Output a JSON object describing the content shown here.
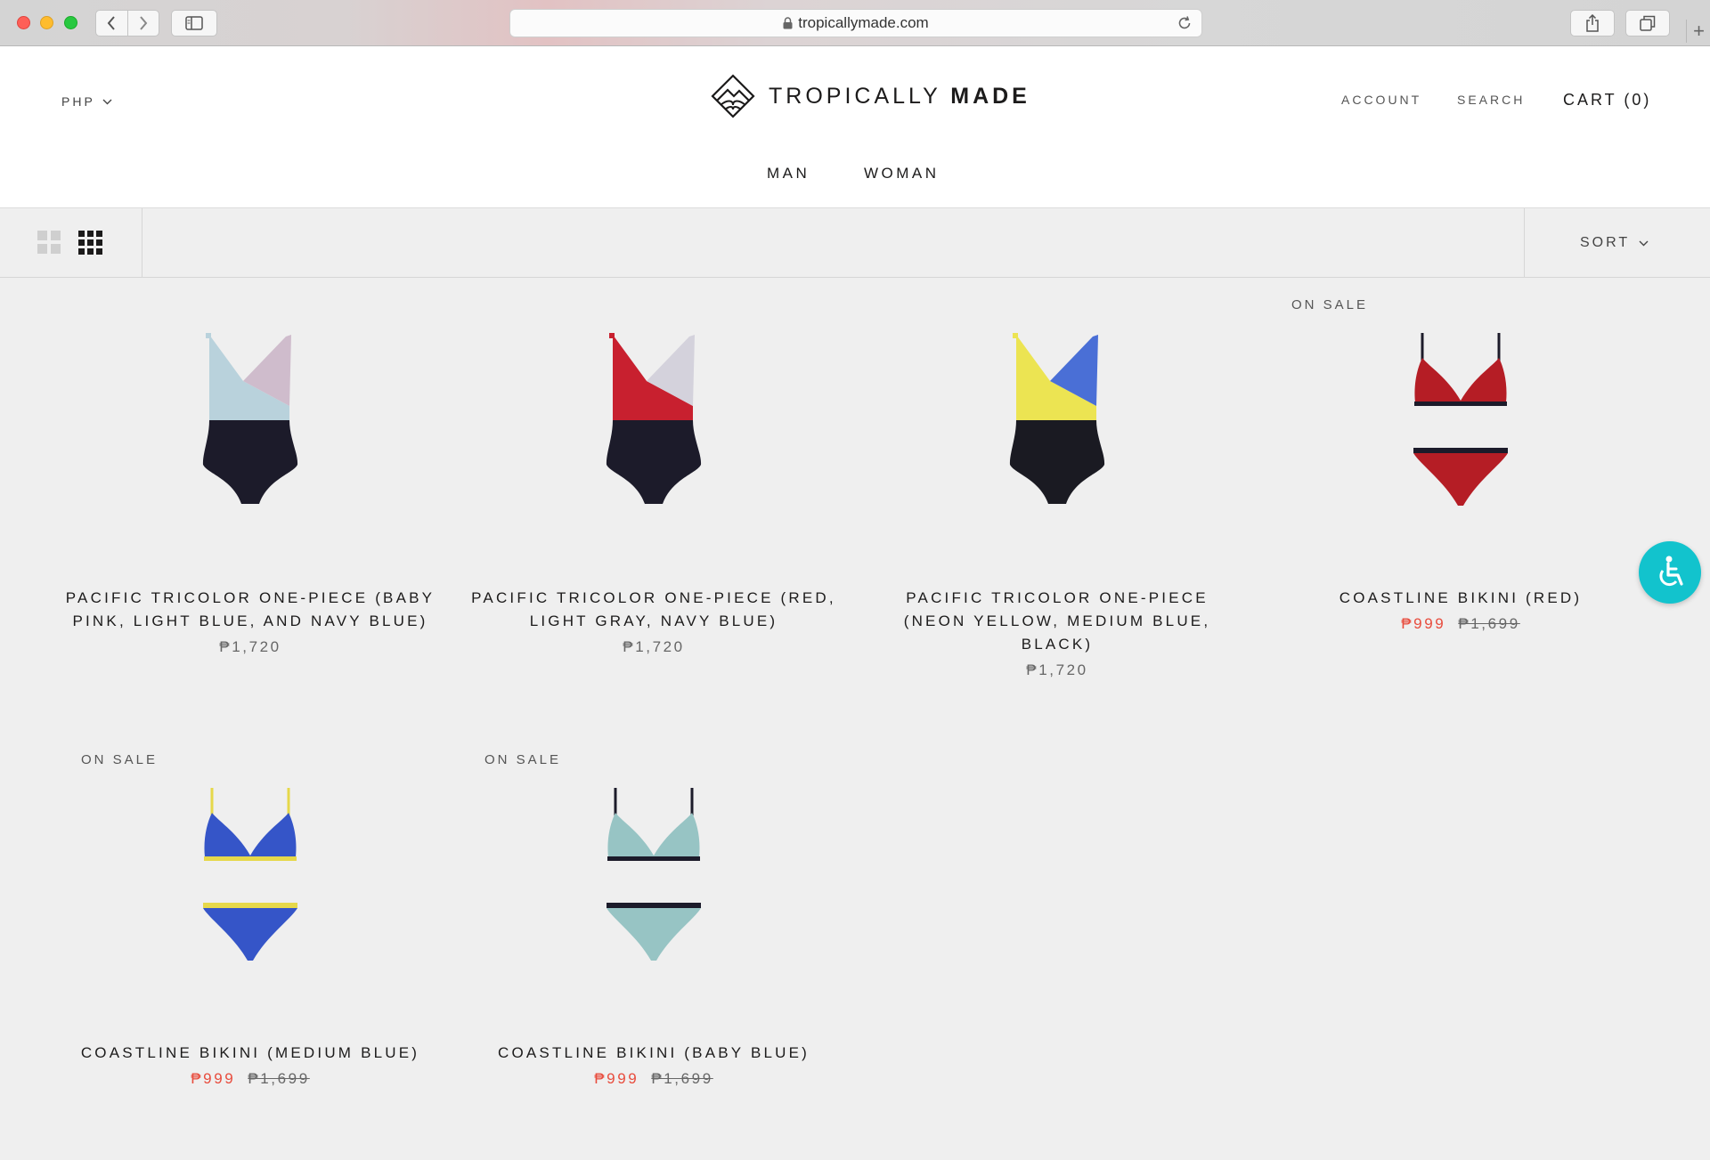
{
  "browser": {
    "url": "tropicallymade.com"
  },
  "header": {
    "currency": "PHP",
    "logo_light": "TROPICALLY ",
    "logo_bold": "MADE",
    "account": "ACCOUNT",
    "search": "SEARCH",
    "cart": "CART (0)",
    "nav": [
      "MAN",
      "WOMAN"
    ]
  },
  "toolbar": {
    "sort_label": "SORT"
  },
  "products": [
    {
      "title_lines": [
        "PACIFIC TRICOLOR ONE-PIECE (BABY",
        "PINK, LIGHT BLUE, AND NAVY BLUE)"
      ],
      "price": "₱1,720",
      "badge": "",
      "image": "onepiece",
      "colors": {
        "left": "#b9d2dc",
        "right": "#cfbccc",
        "bottom": "#1c1b2a"
      }
    },
    {
      "title_lines": [
        "PACIFIC TRICOLOR ONE-PIECE (RED,",
        "LIGHT GRAY, NAVY BLUE)"
      ],
      "price": "₱1,720",
      "badge": "",
      "image": "onepiece",
      "colors": {
        "left": "#c8202f",
        "right": "#d4d2dc",
        "bottom": "#1c1b2a"
      }
    },
    {
      "title_lines": [
        "PACIFIC TRICOLOR ONE-PIECE",
        "(NEON YELLOW, MEDIUM BLUE,",
        "BLACK)"
      ],
      "price": "₱1,720",
      "badge": "",
      "image": "onepiece",
      "colors": {
        "left": "#ece452",
        "right": "#4a6fd6",
        "bottom": "#1a1a22"
      }
    },
    {
      "title_lines": [
        "COASTLINE BIKINI (RED)"
      ],
      "sale_price": "₱999",
      "original_price": "₱1,699",
      "badge": "ON SALE",
      "image": "bikini",
      "colors": {
        "main": "#b51d25",
        "trim": "#1c1b2a",
        "strap": "#1c1b2a"
      }
    },
    {
      "title_lines": [
        "COASTLINE BIKINI (MEDIUM BLUE)"
      ],
      "sale_price": "₱999",
      "original_price": "₱1,699",
      "badge": "ON SALE",
      "image": "bikini",
      "colors": {
        "main": "#3555c8",
        "trim": "#e6d84a",
        "strap": "#e6d84a"
      }
    },
    {
      "title_lines": [
        "COASTLINE BIKINI (BABY BLUE)"
      ],
      "sale_price": "₱999",
      "original_price": "₱1,699",
      "badge": "ON SALE",
      "image": "bikini",
      "colors": {
        "main": "#97c4c4",
        "trim": "#1c1b2a",
        "strap": "#1c1b2a"
      }
    }
  ],
  "icons": {
    "accessibility": "wheelchair-icon",
    "grid_two": "grid-2x2-icon",
    "grid_three": "grid-3x3-icon"
  },
  "colors": {
    "accessibility_button": "#12c3cd",
    "sale_price": "#e84b3c",
    "background": "#efefef"
  }
}
